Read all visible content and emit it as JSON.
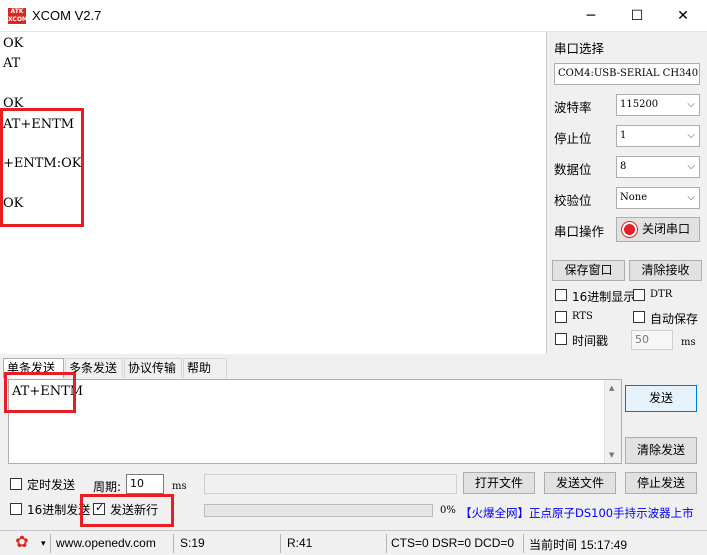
{
  "window": {
    "title": "XCOM V2.7",
    "logo_top": "ATK",
    "logo_bottom": "XCOM",
    "controls": [
      "─",
      "☐",
      "✕"
    ]
  },
  "receive": {
    "lines": [
      "OK",
      "AT",
      "",
      "OK",
      "AT+ENTM",
      "",
      "+ENTM:OK",
      "",
      "OK"
    ]
  },
  "serial_panel": {
    "port_label": "串口选择",
    "port_value": "COM4:USB-SERIAL CH340",
    "baud_label": "波特率",
    "baud_value": "115200",
    "stop_label": "停止位",
    "stop_value": "1",
    "data_label": "数据位",
    "data_value": "8",
    "parity_label": "校验位",
    "parity_value": "None",
    "op_label": "串口操作",
    "op_button": "关闭串口",
    "save_window": "保存窗口",
    "clear_recv": "清除接收",
    "hex_display": "16进制显示",
    "dtr": "DTR",
    "rts": "RTS",
    "auto_save": "自动保存",
    "timestamp": "时间戳",
    "timestamp_value": "50",
    "timestamp_unit": "ms"
  },
  "tabs": [
    "单条发送",
    "多条发送",
    "协议传输",
    "帮助"
  ],
  "send": {
    "text": "AT+ENTM",
    "send_button": "发送",
    "clear_send_button": "清除发送",
    "timed_send": "定时发送",
    "period_label": "周期:",
    "period_value": "10",
    "period_unit": "ms",
    "open_file": "打开文件",
    "send_file": "发送文件",
    "stop_send": "停止发送",
    "hex_send": "16进制发送",
    "send_newline": "发送新行",
    "send_newline_checked": true,
    "progress": "0%",
    "ad_text": "【火爆全网】正点原子DS100手持示波器上市"
  },
  "status": {
    "url": "www.openedv.com",
    "s": "S:19",
    "r": "R:41",
    "signals": "CTS=0 DSR=0 DCD=0",
    "time": "当前时间 15:17:49"
  },
  "colors": {
    "highlight": "#e81e25",
    "ad_blue": "#0000ff",
    "ad_red": "#e81e25",
    "gear": "#d9291c"
  }
}
